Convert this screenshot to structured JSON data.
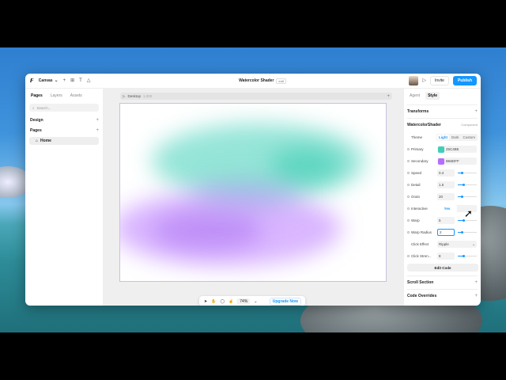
{
  "topbar": {
    "project_name": "Canvas",
    "doc_title": "Watercolor Shader",
    "doc_badge": "edit",
    "invite_label": "Invite",
    "publish_label": "Publish"
  },
  "left_panel": {
    "tabs": [
      {
        "label": "Pages"
      },
      {
        "label": "Layers"
      },
      {
        "label": "Assets"
      }
    ],
    "search_placeholder": "Search...",
    "design_label": "Design",
    "pages_label": "Pages",
    "page_items": [
      {
        "label": "Home"
      }
    ]
  },
  "canvas": {
    "frame_name": "Desktop",
    "frame_size": "1,000",
    "zoom": "74%",
    "upgrade_label": "Upgrade Now"
  },
  "right_panel": {
    "tabs": [
      {
        "label": "Agent"
      },
      {
        "label": "Style"
      }
    ],
    "transforms_label": "Transforms",
    "component_name": "WatercolorShader",
    "component_tag": "Component",
    "theme": {
      "label": "Theme",
      "options": [
        "Light",
        "Dark",
        "Custom"
      ],
      "selected": "Light"
    },
    "primary": {
      "label": "Primary",
      "value": "25C4B5",
      "color": "#3ecfb8"
    },
    "secondary": {
      "label": "Secondary",
      "value": "B66DFF",
      "color": "#b66dff"
    },
    "speed": {
      "label": "Speed",
      "value": "0.4",
      "level": 0.2
    },
    "detail": {
      "label": "Detail",
      "value": "1.5",
      "level": 0.3
    },
    "grain": {
      "label": "Grain",
      "value": "20",
      "level": 0.2
    },
    "interactive": {
      "label": "Interactive",
      "options": [
        "Yes",
        "No"
      ],
      "selected": "Yes"
    },
    "warp": {
      "label": "Warp",
      "value": "5",
      "level": 0.3
    },
    "warp_radius": {
      "label": "Warp Radius",
      "value": "2",
      "level": 0.2
    },
    "click_effect": {
      "label": "Click Effect",
      "value": "Ripple"
    },
    "click_strength": {
      "label": "Click Stren...",
      "value": "8",
      "level": 0.3
    },
    "edit_code_label": "Edit Code",
    "scroll_section_label": "Scroll Section",
    "code_overrides_label": "Code Overrides"
  }
}
